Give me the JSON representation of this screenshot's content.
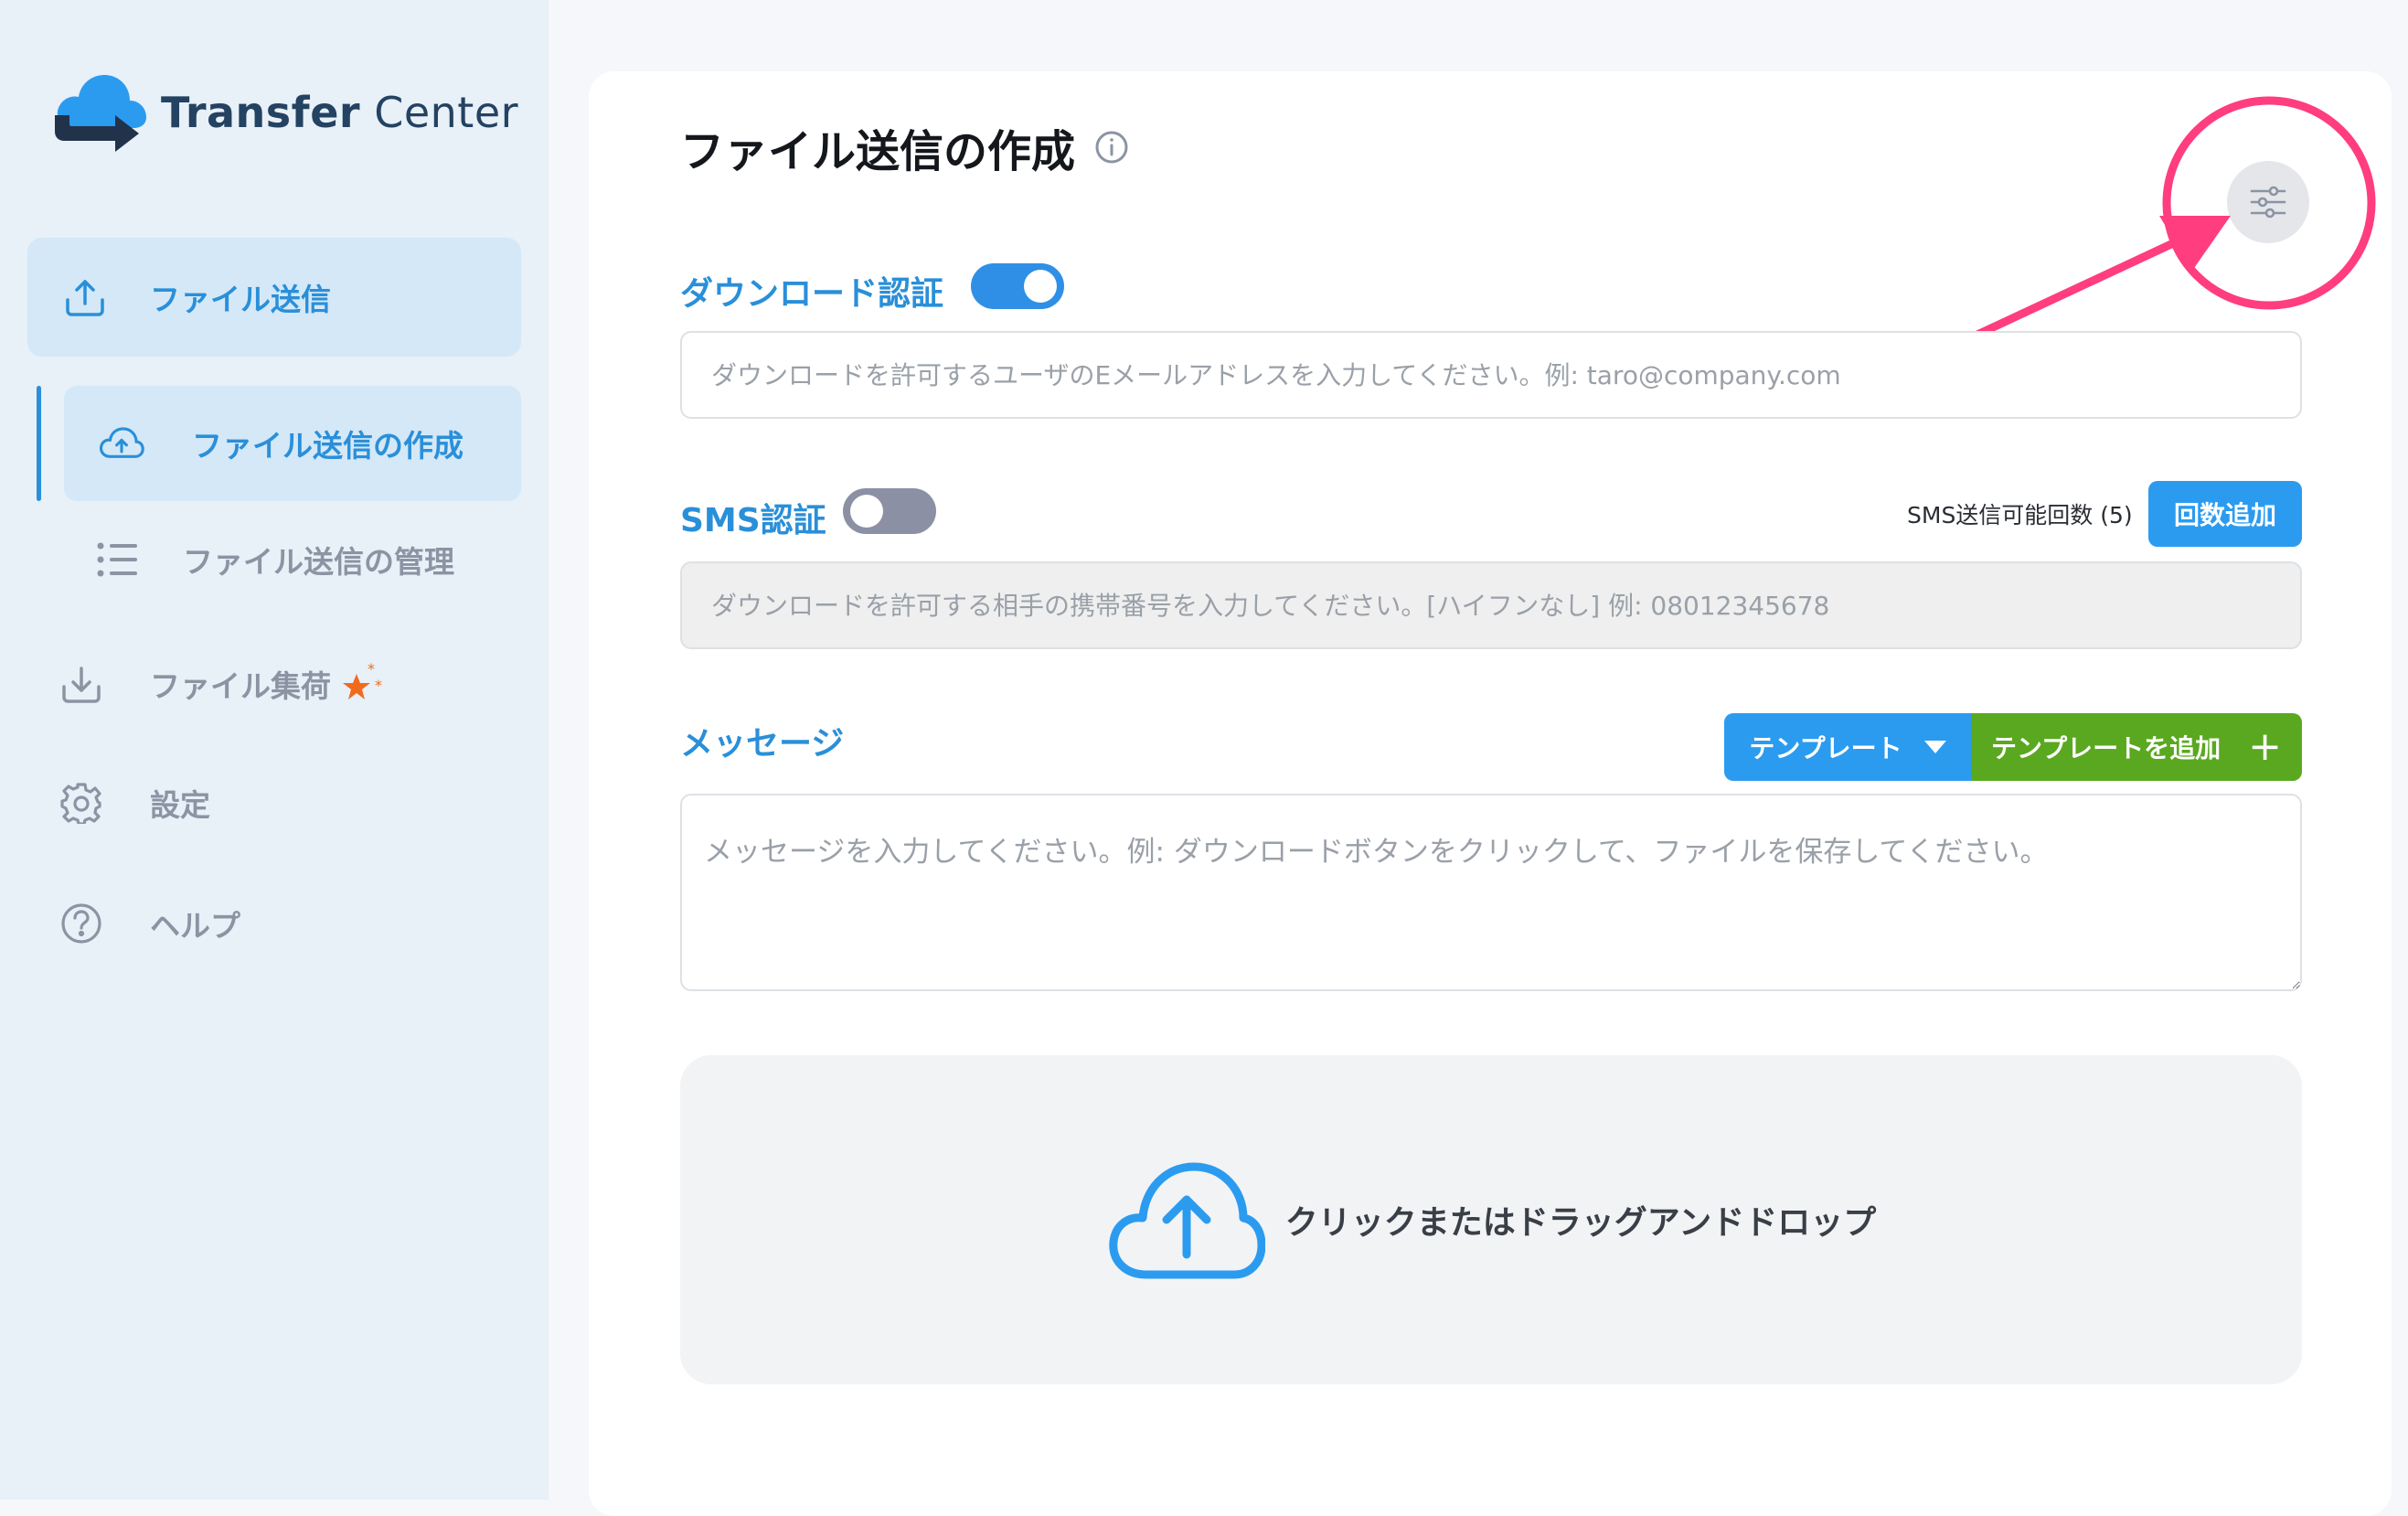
{
  "app": {
    "logo_primary": "Transfer",
    "logo_secondary": "Center"
  },
  "sidebar": {
    "items": [
      {
        "label": "ファイル送信",
        "icon": "upload-tray-icon"
      },
      {
        "label": "ファイル送信の作成",
        "icon": "cloud-upload-icon"
      },
      {
        "label": "ファイル送信の管理",
        "icon": "list-icon"
      },
      {
        "label": "ファイル集荷",
        "icon": "download-tray-icon"
      },
      {
        "label": "設定",
        "icon": "gear-icon"
      },
      {
        "label": "ヘルプ",
        "icon": "help-circle-icon"
      }
    ],
    "new_badge_color": "#f26b1d"
  },
  "main": {
    "title": "ファイル送信の作成",
    "download_auth": {
      "label": "ダウンロード認証",
      "enabled": true,
      "placeholder": "ダウンロードを許可するユーザのEメールアドレスを入力してください。例: taro@company.com"
    },
    "sms_auth": {
      "label": "SMS認証",
      "enabled": false,
      "remaining_label": "SMS送信可能回数 (5)",
      "add_button": "回数追加",
      "placeholder": "ダウンロードを許可する相手の携帯番号を入力してください。[ハイフンなし] 例: 08012345678"
    },
    "message": {
      "label": "メッセージ",
      "template_button": "テンプレート",
      "add_template_button": "テンプレートを追加",
      "placeholder": "メッセージを入力してください。例: ダウンロードボタンをクリックして、ファイルを保存してください。"
    },
    "dropzone": {
      "text": "クリックまたはドラッグアンドドロップ"
    }
  },
  "colors": {
    "accent": "#2a8fd9",
    "toggle_on": "#2f8fe6",
    "toggle_off": "#8c90a4",
    "template_green": "#5aa81f",
    "annotation_pink": "#ff3d7f"
  }
}
